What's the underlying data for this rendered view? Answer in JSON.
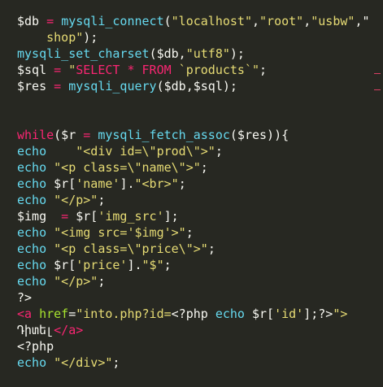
{
  "colors": {
    "background": "#272822",
    "text": "#f8f8f2",
    "function": "#66d9ef",
    "string": "#e6db74",
    "keyword": "#f92672",
    "attribute": "#a6e22e",
    "gutter_marker": "#d83f63"
  },
  "code_lines": [
    {
      "row": 0,
      "tokens": [
        {
          "t": "$db",
          "c": "default"
        },
        {
          "t": " = ",
          "c": "op"
        },
        {
          "t": "mysqli_connect",
          "c": "fn"
        },
        {
          "t": "(",
          "c": "default"
        },
        {
          "t": "\"localhost\"",
          "c": "str"
        },
        {
          "t": ",",
          "c": "default"
        },
        {
          "t": "\"root\"",
          "c": "str"
        },
        {
          "t": ",",
          "c": "default"
        },
        {
          "t": "\"usbw\"",
          "c": "str"
        },
        {
          "t": ",\"",
          "c": "default"
        }
      ]
    },
    {
      "row": 1,
      "tokens": [
        {
          "t": "    shop\"",
          "c": "str"
        },
        {
          "t": ");",
          "c": "default"
        }
      ]
    },
    {
      "row": 2,
      "tokens": [
        {
          "t": "mysqli_set_charset",
          "c": "fn"
        },
        {
          "t": "($db,",
          "c": "default"
        },
        {
          "t": "\"utf8\"",
          "c": "str"
        },
        {
          "t": ");",
          "c": "default"
        }
      ]
    },
    {
      "row": 3,
      "tokens": [
        {
          "t": "$sql",
          "c": "default"
        },
        {
          "t": " = ",
          "c": "op"
        },
        {
          "t": "\"",
          "c": "str"
        },
        {
          "t": "SELECT * FROM ",
          "c": "sqlkw"
        },
        {
          "t": "`products`",
          "c": "str"
        },
        {
          "t": "\"",
          "c": "str"
        },
        {
          "t": ";",
          "c": "default"
        }
      ]
    },
    {
      "row": 4,
      "tokens": [
        {
          "t": "$res",
          "c": "default"
        },
        {
          "t": " = ",
          "c": "op"
        },
        {
          "t": "mysqli_query",
          "c": "fn"
        },
        {
          "t": "($db,$sql);",
          "c": "default"
        }
      ]
    },
    {
      "row": 7,
      "tokens": [
        {
          "t": "while",
          "c": "kw"
        },
        {
          "t": "($r",
          "c": "default"
        },
        {
          "t": " = ",
          "c": "op"
        },
        {
          "t": "mysqli_fetch_assoc",
          "c": "fn"
        },
        {
          "t": "($res)){",
          "c": "default"
        }
      ]
    },
    {
      "row": 8,
      "tokens": [
        {
          "t": "echo",
          "c": "echo"
        },
        {
          "t": "    ",
          "c": "default"
        },
        {
          "t": "\"<div id=\\\"prod\\\">\"",
          "c": "str"
        },
        {
          "t": ";",
          "c": "default"
        }
      ]
    },
    {
      "row": 9,
      "tokens": [
        {
          "t": "echo",
          "c": "echo"
        },
        {
          "t": " ",
          "c": "default"
        },
        {
          "t": "\"<p class=\\\"name\\\">\"",
          "c": "str"
        },
        {
          "t": ";",
          "c": "default"
        }
      ]
    },
    {
      "row": 10,
      "tokens": [
        {
          "t": "echo",
          "c": "echo"
        },
        {
          "t": " $r[",
          "c": "default"
        },
        {
          "t": "'name'",
          "c": "str"
        },
        {
          "t": "].",
          "c": "default"
        },
        {
          "t": "\"<br>\"",
          "c": "str"
        },
        {
          "t": ";",
          "c": "default"
        }
      ]
    },
    {
      "row": 11,
      "tokens": [
        {
          "t": "echo",
          "c": "echo"
        },
        {
          "t": " ",
          "c": "default"
        },
        {
          "t": "\"</p>\"",
          "c": "str"
        },
        {
          "t": ";",
          "c": "default"
        }
      ]
    },
    {
      "row": 12,
      "tokens": [
        {
          "t": "$img",
          "c": "default"
        },
        {
          "t": "  = ",
          "c": "op"
        },
        {
          "t": "$r[",
          "c": "default"
        },
        {
          "t": "'img_src'",
          "c": "str"
        },
        {
          "t": "];",
          "c": "default"
        }
      ]
    },
    {
      "row": 13,
      "tokens": [
        {
          "t": "echo",
          "c": "echo"
        },
        {
          "t": " ",
          "c": "default"
        },
        {
          "t": "\"<img src='$img'>\"",
          "c": "str"
        },
        {
          "t": ";",
          "c": "default"
        }
      ]
    },
    {
      "row": 14,
      "tokens": [
        {
          "t": "echo",
          "c": "echo"
        },
        {
          "t": " ",
          "c": "default"
        },
        {
          "t": "\"<p class=\\\"price\\\">\"",
          "c": "str"
        },
        {
          "t": ";",
          "c": "default"
        }
      ]
    },
    {
      "row": 15,
      "tokens": [
        {
          "t": "echo",
          "c": "echo"
        },
        {
          "t": " $r[",
          "c": "default"
        },
        {
          "t": "'price'",
          "c": "str"
        },
        {
          "t": "].",
          "c": "default"
        },
        {
          "t": "\"$\"",
          "c": "str"
        },
        {
          "t": ";",
          "c": "default"
        }
      ]
    },
    {
      "row": 16,
      "tokens": [
        {
          "t": "echo",
          "c": "echo"
        },
        {
          "t": " ",
          "c": "default"
        },
        {
          "t": "\"</p>\"",
          "c": "str"
        },
        {
          "t": ";",
          "c": "default"
        }
      ]
    },
    {
      "row": 17,
      "tokens": [
        {
          "t": "?>",
          "c": "default"
        }
      ]
    },
    {
      "row": 18,
      "tokens": [
        {
          "t": "<a",
          "c": "tag"
        },
        {
          "t": " ",
          "c": "default"
        },
        {
          "t": "href",
          "c": "attr"
        },
        {
          "t": "=",
          "c": "default"
        },
        {
          "t": "\"into.php?id=",
          "c": "str"
        },
        {
          "t": "<?php",
          "c": "default"
        },
        {
          "t": " ",
          "c": "default"
        },
        {
          "t": "echo",
          "c": "echo"
        },
        {
          "t": " $r[",
          "c": "default"
        },
        {
          "t": "'id'",
          "c": "str"
        },
        {
          "t": "];?>",
          "c": "default"
        },
        {
          "t": "\">",
          "c": "str"
        }
      ]
    },
    {
      "row": 19,
      "tokens": [
        {
          "t": "Դիտել",
          "c": "default"
        },
        {
          "t": "</a>",
          "c": "tag"
        }
      ]
    },
    {
      "row": 20,
      "tokens": [
        {
          "t": "<?php",
          "c": "default"
        }
      ]
    },
    {
      "row": 21,
      "tokens": [
        {
          "t": "echo",
          "c": "echo"
        },
        {
          "t": " ",
          "c": "default"
        },
        {
          "t": "\"</div>\"",
          "c": "str"
        },
        {
          "t": ";",
          "c": "default"
        }
      ]
    }
  ],
  "gutter_markers": [
    {
      "row": 3
    },
    {
      "row": 4
    }
  ]
}
